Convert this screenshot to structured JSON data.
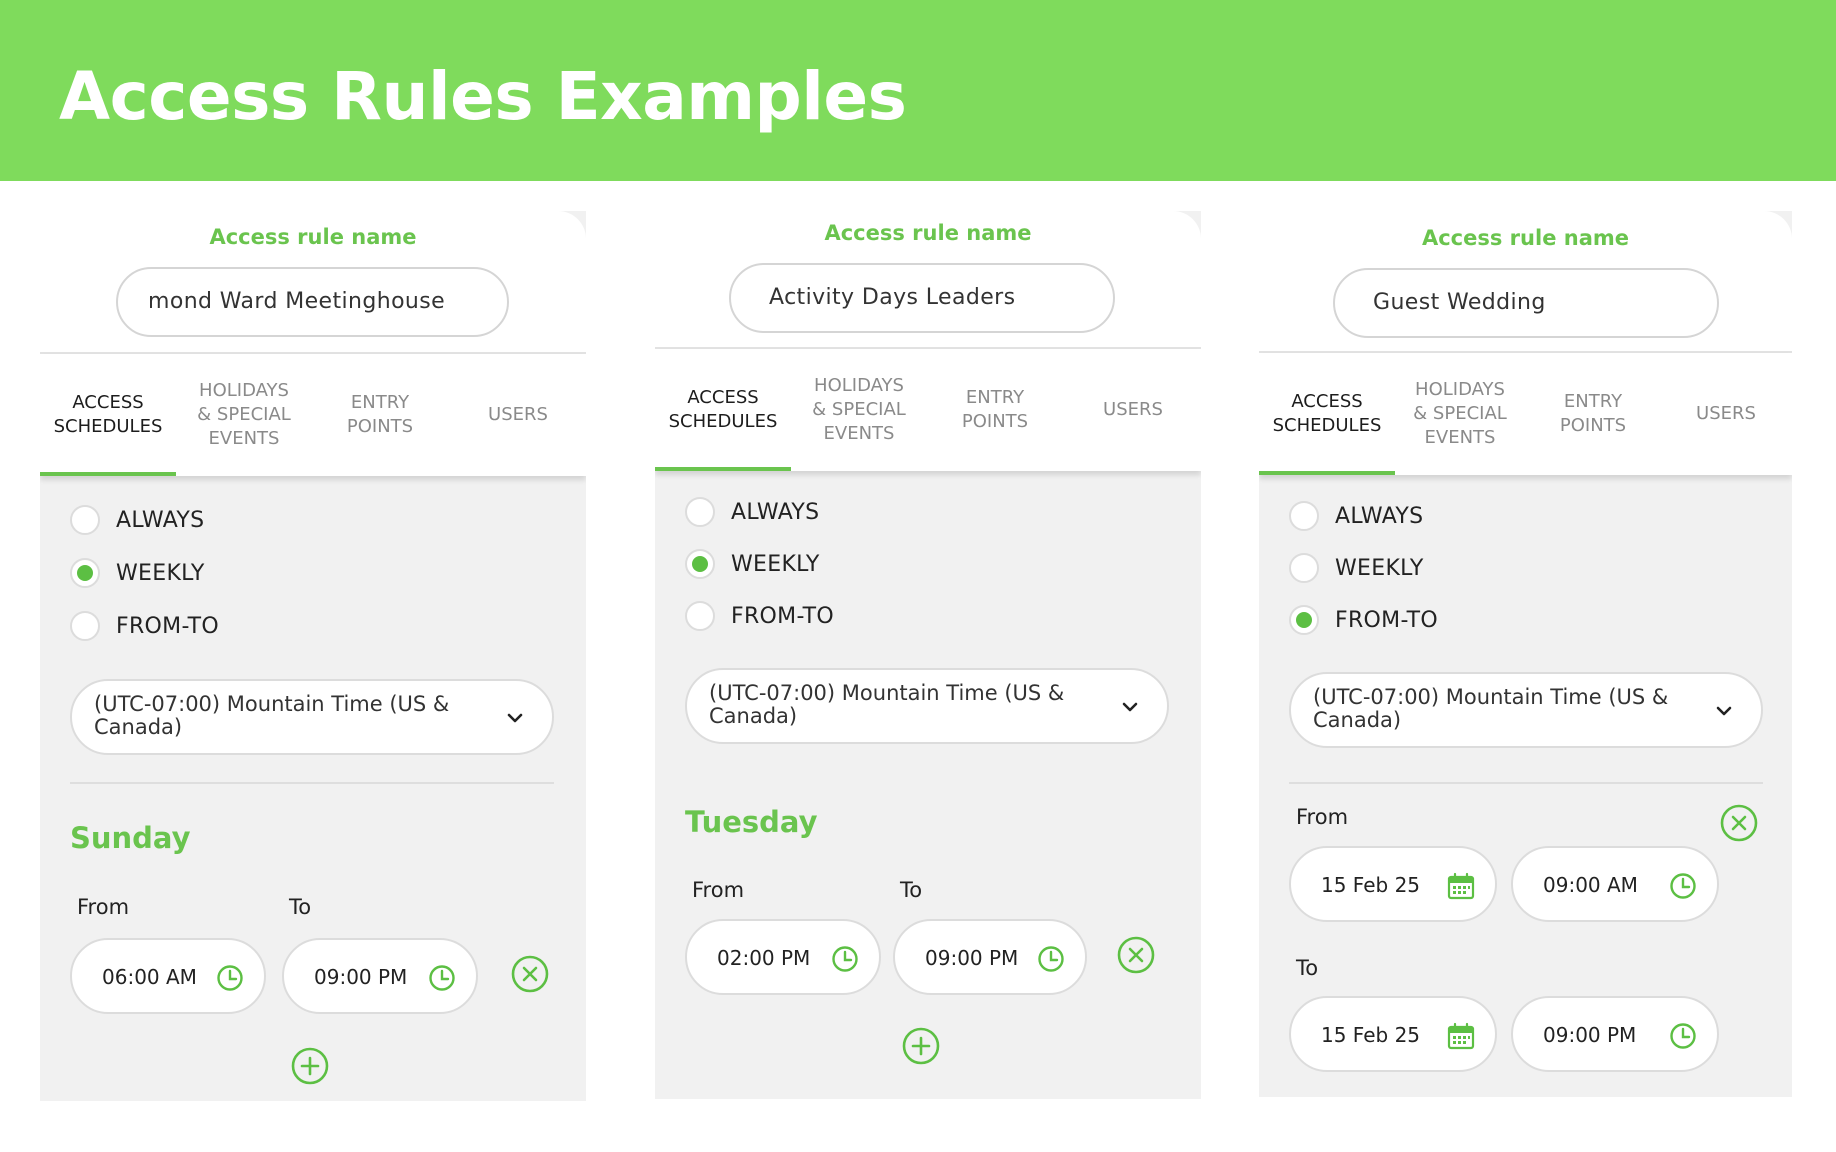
{
  "banner": {
    "title": "Access Rules Examples"
  },
  "colors": {
    "accent": "#6ac44e",
    "banner": "#7fdb5c",
    "panel_bg": "#f1f1f1"
  },
  "panels": [
    {
      "rule_label": "Access rule name",
      "rule_name": "mond Ward Meetinghouse",
      "tabs": [
        {
          "line1": "ACCESS",
          "line2": "SCHEDULES",
          "line3": ""
        },
        {
          "line1": "HOLIDAYS",
          "line2": "& SPECIAL",
          "line3": "EVENTS"
        },
        {
          "line1": "ENTRY",
          "line2": "POINTS",
          "line3": ""
        },
        {
          "line1": "USERS",
          "line2": "",
          "line3": ""
        }
      ],
      "options": [
        "ALWAYS",
        "WEEKLY",
        "FROM-TO"
      ],
      "selected": "WEEKLY",
      "timezone": "(UTC-07:00) Mountain Time (US & Canada)",
      "day": "Sunday",
      "from_label": "From",
      "to_label": "To",
      "from_time": "06:00 AM",
      "to_time": "09:00 PM"
    },
    {
      "rule_label": "Access rule name",
      "rule_name": "Activity Days Leaders",
      "tabs": [
        {
          "line1": "ACCESS",
          "line2": "SCHEDULES",
          "line3": ""
        },
        {
          "line1": "HOLIDAYS",
          "line2": "& SPECIAL",
          "line3": "EVENTS"
        },
        {
          "line1": "ENTRY",
          "line2": "POINTS",
          "line3": ""
        },
        {
          "line1": "USERS",
          "line2": "",
          "line3": ""
        }
      ],
      "options": [
        "ALWAYS",
        "WEEKLY",
        "FROM-TO"
      ],
      "selected": "WEEKLY",
      "timezone": "(UTC-07:00) Mountain Time (US & Canada)",
      "day": "Tuesday",
      "from_label": "From",
      "to_label": "To",
      "from_time": "02:00 PM",
      "to_time": "09:00 PM"
    },
    {
      "rule_label": "Access rule name",
      "rule_name": "Guest Wedding",
      "tabs": [
        {
          "line1": "ACCESS",
          "line2": "SCHEDULES",
          "line3": ""
        },
        {
          "line1": "HOLIDAYS",
          "line2": "& SPECIAL",
          "line3": "EVENTS"
        },
        {
          "line1": "ENTRY",
          "line2": "POINTS",
          "line3": ""
        },
        {
          "line1": "USERS",
          "line2": "",
          "line3": ""
        }
      ],
      "options": [
        "ALWAYS",
        "WEEKLY",
        "FROM-TO"
      ],
      "selected": "FROM-TO",
      "timezone": "(UTC-07:00) Mountain Time (US & Canada)",
      "from_label": "From",
      "to_label": "To",
      "from_date": "15 Feb 25",
      "from_time": "09:00 AM",
      "to_date": "15 Feb 25",
      "to_time": "09:00 PM"
    }
  ]
}
